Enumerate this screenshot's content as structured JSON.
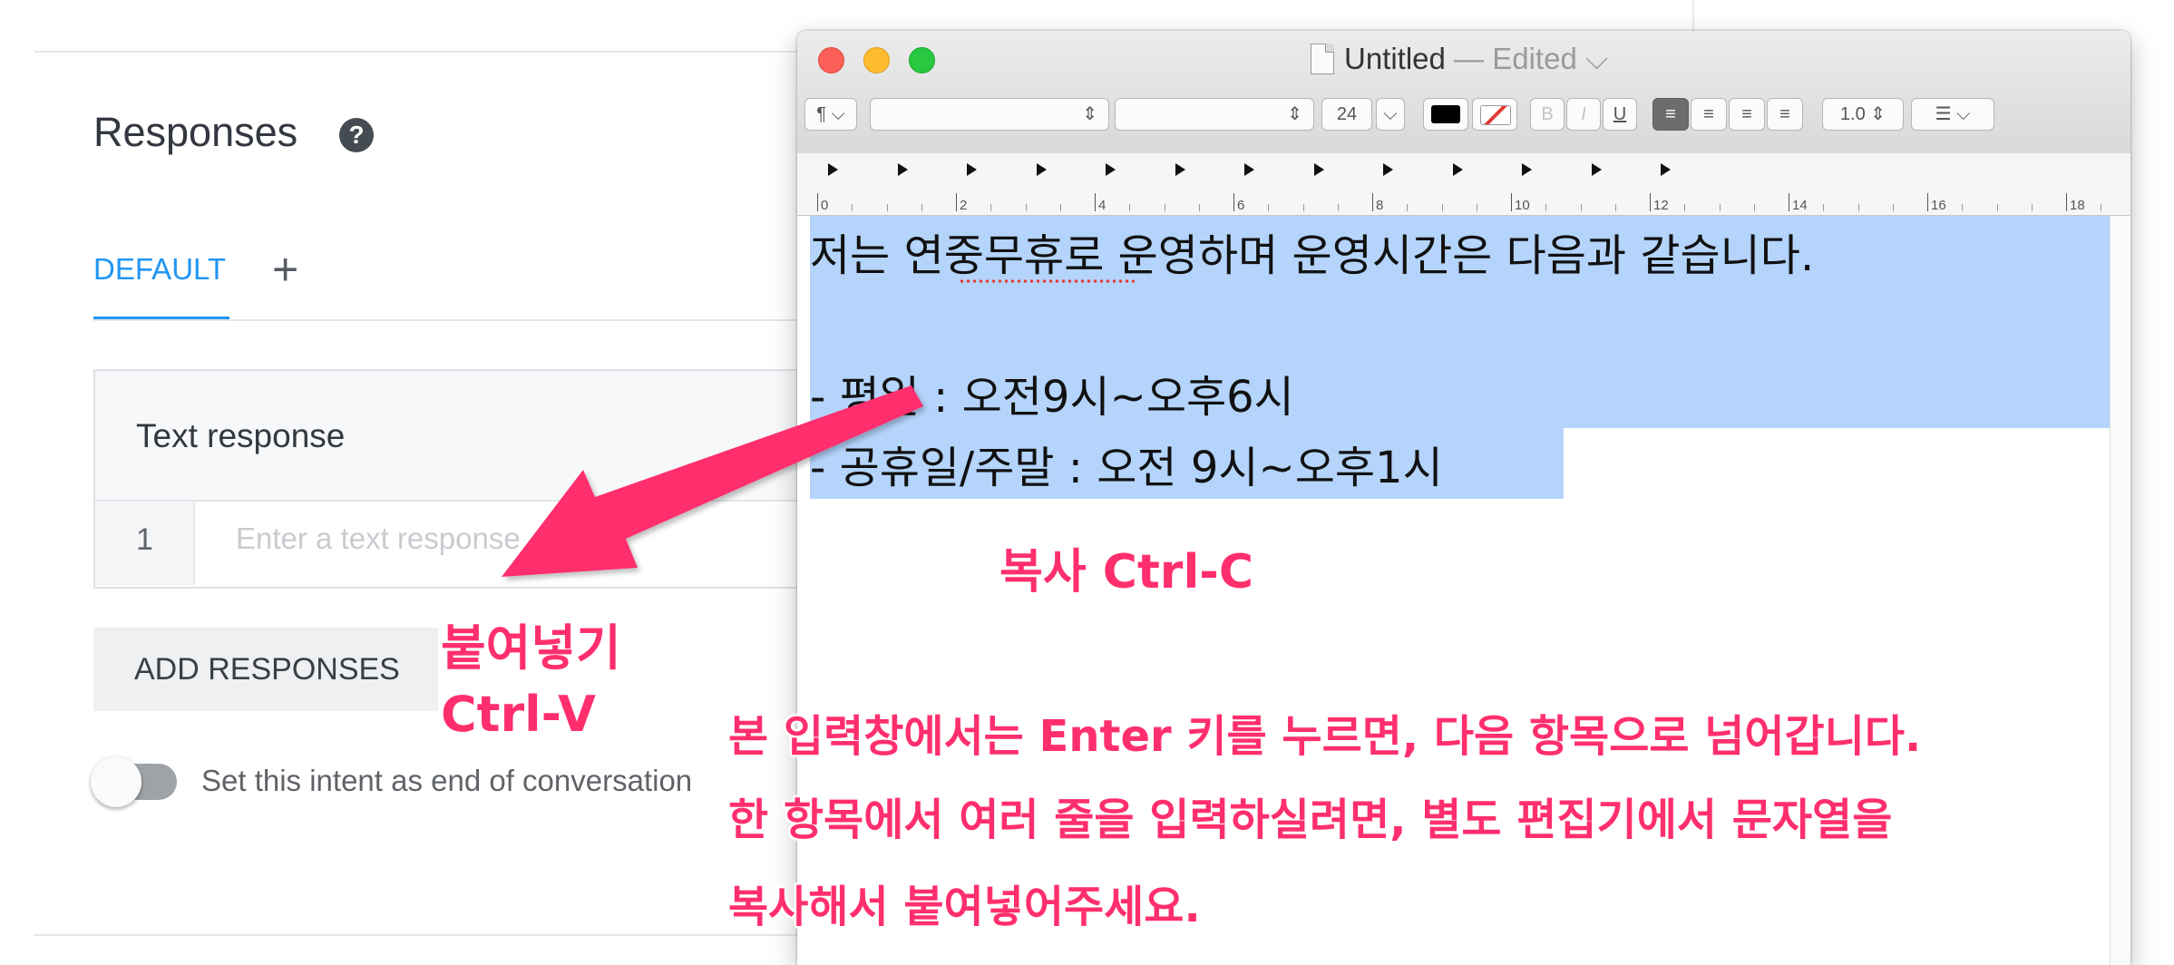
{
  "responses_panel": {
    "title": "Responses",
    "help_icon": "help-circle-icon",
    "tabs": [
      {
        "label": "DEFAULT",
        "active": true
      }
    ],
    "add_tab_glyph": "+",
    "card": {
      "title": "Text response",
      "rows": [
        {
          "number": "1",
          "placeholder": "Enter a text response"
        }
      ]
    },
    "add_responses_label": "ADD RESPONSES",
    "end_conversation_toggle": {
      "label": "Set this intent as end of conversation",
      "on": false
    }
  },
  "textedit_window": {
    "title": "Untitled",
    "title_status": " — Edited",
    "title_chevron": "⌵",
    "toolbar": {
      "paragraph_menu": "¶",
      "font_size": "24",
      "bold": "B",
      "italic": "I",
      "underline": "U",
      "line_spacing": "1.0",
      "text_color": "#000000",
      "active_alignment": "left"
    },
    "ruler_numbers": [
      "0",
      "2",
      "4",
      "6",
      "8",
      "10",
      "12",
      "14",
      "16",
      "18"
    ],
    "document_lines": [
      "저는 연중무휴로 운영하며 운영시간은 다음과 같습니다.",
      "",
      "- 평일 : 오전9시~오후6시",
      "- 공휴일/주말 : 오전 9시~오후1시"
    ],
    "selection_color": "#b4d4fb"
  },
  "annotations": {
    "copy": "복사 Ctrl-C",
    "paste_line1": "붙여넣기",
    "paste_line2": "Ctrl-V",
    "note_lines": [
      "본 입력창에서는 Enter 키를 누르면, 다음 항목으로 넘어갑니다.",
      "한 항목에서 여러 줄을 입력하실려면, 별도 편집기에서 문자열을",
      "복사해서 붙여넣어주세요."
    ],
    "color": "#ff2f6d"
  }
}
